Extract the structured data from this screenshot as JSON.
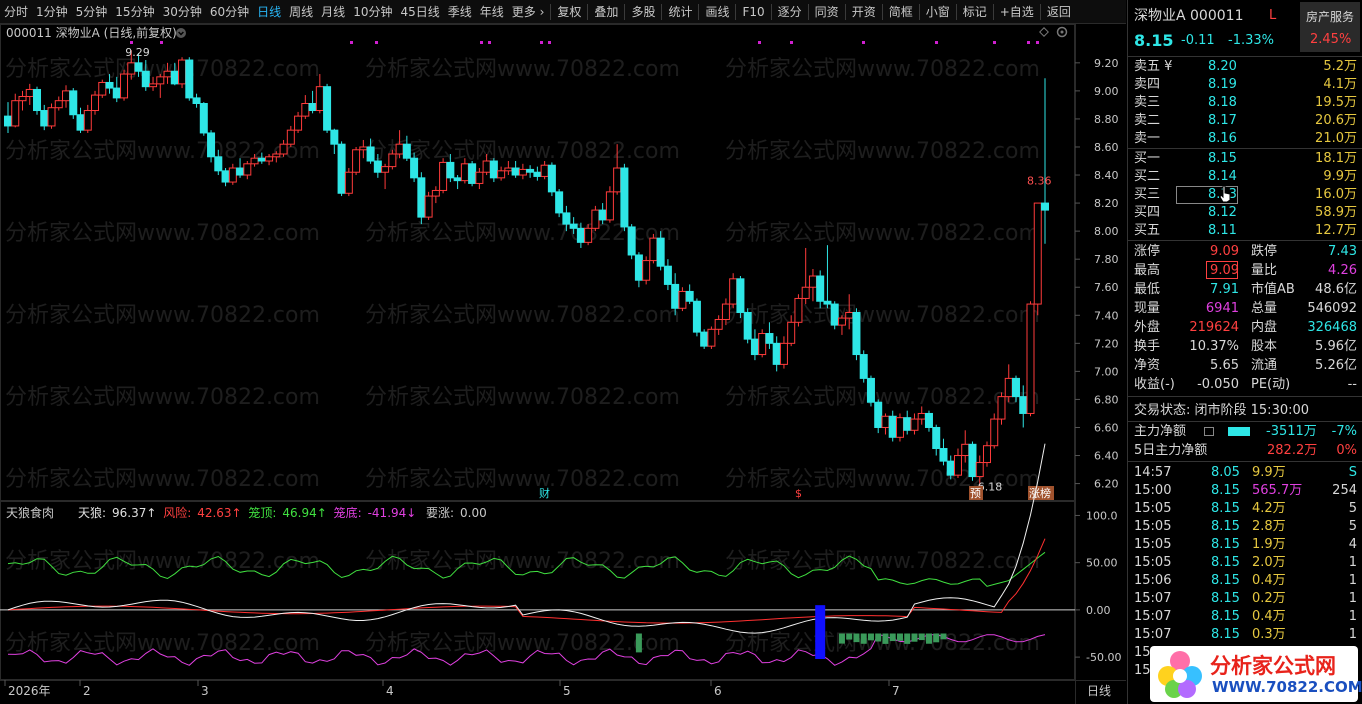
{
  "toolbar": {
    "items": [
      "分时",
      "1分钟",
      "5分钟",
      "15分钟",
      "30分钟",
      "60分钟",
      "日线",
      "周线",
      "月线",
      "10分钟",
      "45日线",
      "季线",
      "年线",
      "更多 ›"
    ],
    "active_index": 6,
    "tools": [
      "复权",
      "叠加",
      "多股",
      "统计",
      "画线",
      "F10",
      "逐分",
      "同资",
      "开资",
      "简框",
      "小窗",
      "标记",
      "+自选",
      "返回"
    ]
  },
  "chart": {
    "title": "000011 深物业A (日线,前复权)",
    "high_label": "9.29",
    "low_label": "6.18",
    "last_label": "8.36",
    "y_ticks": [
      "9.20",
      "9.00",
      "8.80",
      "8.60",
      "8.40",
      "8.20",
      "8.00",
      "7.80",
      "7.60",
      "7.40",
      "7.20",
      "7.00",
      "6.80",
      "6.60",
      "6.40",
      "6.20"
    ],
    "markers": {
      "cai": "财",
      "dollar": "$",
      "yu": "预",
      "zhangting": "涨榜"
    },
    "x_labels": [
      "2026年",
      "2",
      "3",
      "4",
      "5",
      "6",
      "7"
    ],
    "period": "日线",
    "watermark": "分析家公式网www.70822.com"
  },
  "indicator": {
    "name": "天狼食肉",
    "items": [
      {
        "label": "天狼:",
        "value": "96.37↑",
        "color": "#e0e0e0"
      },
      {
        "label": "风险:",
        "value": "42.63↑",
        "color": "#ff4040"
      },
      {
        "label": "笼顶:",
        "value": "46.94↑",
        "color": "#40e040"
      },
      {
        "label": "笼底:",
        "value": "-41.94↓",
        "color": "#e040e0"
      },
      {
        "label": "要涨:",
        "value": "0.00",
        "color": "#c8c8c8"
      }
    ],
    "y_ticks": [
      "100.0",
      "50.00",
      "0.00",
      "-50.00"
    ]
  },
  "quote": {
    "name": "深物业A 000011",
    "flag": "L",
    "sector": "房产服务",
    "sector_pct": "2.45%",
    "price": "8.15",
    "change": "-0.11",
    "change_pct": "-1.33%",
    "sells": [
      {
        "label": "卖五 ¥",
        "price": "8.20",
        "vol": "5.2万"
      },
      {
        "label": "卖四",
        "price": "8.19",
        "vol": "4.1万"
      },
      {
        "label": "卖三",
        "price": "8.18",
        "vol": "19.5万"
      },
      {
        "label": "卖二",
        "price": "8.17",
        "vol": "20.6万"
      },
      {
        "label": "卖一",
        "price": "8.16",
        "vol": "21.0万"
      }
    ],
    "buys": [
      {
        "label": "买一",
        "price": "8.15",
        "vol": "18.1万"
      },
      {
        "label": "买二",
        "price": "8.14",
        "vol": "9.9万"
      },
      {
        "label": "买三",
        "price": "8.13",
        "vol": "16.0万"
      },
      {
        "label": "买四",
        "price": "8.12",
        "vol": "58.9万"
      },
      {
        "label": "买五",
        "price": "8.11",
        "vol": "12.7万"
      }
    ],
    "stats": [
      {
        "l1": "涨停",
        "v1": "9.09",
        "c1": "c-r",
        "l2": "跌停",
        "v2": "7.43",
        "c2": "c-g"
      },
      {
        "l1": "最高",
        "v1": "9.09",
        "c1": "c-r",
        "l2": "量比",
        "v2": "4.26",
        "c2": "c-m"
      },
      {
        "l1": "最低",
        "v1": "7.91",
        "c1": "c-g",
        "l2": "市值AB",
        "v2": "48.6亿",
        "c2": "c-w"
      },
      {
        "l1": "现量",
        "v1": "6941",
        "c1": "c-m",
        "l2": "总量",
        "v2": "546092",
        "c2": "c-w"
      },
      {
        "l1": "外盘",
        "v1": "219624",
        "c1": "c-r",
        "l2": "内盘",
        "v2": "326468",
        "c2": "c-g"
      },
      {
        "l1": "换手",
        "v1": "10.37%",
        "c1": "c-w",
        "l2": "股本",
        "v2": "5.96亿",
        "c2": "c-w"
      },
      {
        "l1": "净资",
        "v1": "5.65",
        "c1": "c-w",
        "l2": "流通",
        "v2": "5.26亿",
        "c2": "c-w"
      },
      {
        "l1": "收益(-)",
        "v1": "-0.050",
        "c1": "c-w",
        "l2": "PE(动)",
        "v2": "--",
        "c2": "c-w"
      }
    ],
    "status": "交易状态: 闭市阶段 15:30:00",
    "main_flow": {
      "label": "主力净额",
      "value": "-3511万",
      "pct": "-7%"
    },
    "main_flow5": {
      "label": "5日主力净额",
      "value": "282.2万",
      "pct": "0%"
    },
    "ticks": [
      {
        "t": "14:57",
        "p": "8.05",
        "v": "9.9万",
        "n": "S",
        "vc": "c-y",
        "nc": "c-g"
      },
      {
        "t": "15:00",
        "p": "8.15",
        "v": "565.7万",
        "n": "254",
        "vc": "c-m",
        "nc": "c-w"
      },
      {
        "t": "15:05",
        "p": "8.15",
        "v": "4.2万",
        "n": "5",
        "vc": "c-y",
        "nc": "c-w"
      },
      {
        "t": "15:05",
        "p": "8.15",
        "v": "2.8万",
        "n": "5",
        "vc": "c-y",
        "nc": "c-w"
      },
      {
        "t": "15:05",
        "p": "8.15",
        "v": "1.9万",
        "n": "4",
        "vc": "c-y",
        "nc": "c-w"
      },
      {
        "t": "15:05",
        "p": "8.15",
        "v": "2.0万",
        "n": "1",
        "vc": "c-y",
        "nc": "c-w"
      },
      {
        "t": "15:06",
        "p": "8.15",
        "v": "0.4万",
        "n": "1",
        "vc": "c-y",
        "nc": "c-w"
      },
      {
        "t": "15:07",
        "p": "8.15",
        "v": "0.2万",
        "n": "1",
        "vc": "c-y",
        "nc": "c-w"
      },
      {
        "t": "15:07",
        "p": "8.15",
        "v": "0.4万",
        "n": "1",
        "vc": "c-y",
        "nc": "c-w"
      },
      {
        "t": "15:07",
        "p": "8.15",
        "v": "0.3万",
        "n": "1",
        "vc": "c-y",
        "nc": "c-w"
      },
      {
        "t": "15",
        "p": "",
        "v": "",
        "n": "",
        "vc": "c-y",
        "nc": "c-w"
      },
      {
        "t": "15",
        "p": "",
        "v": "",
        "n": "",
        "vc": "c-y",
        "nc": "c-w"
      }
    ]
  },
  "logo": {
    "text": "分析家公式网",
    "url": "WWW.70822.COM"
  },
  "colors": {
    "up": "#ff3b3b",
    "down": "#2ee6e6",
    "accent": "#29b6f6",
    "grid": "#1a1a1a"
  },
  "chart_data": {
    "type": "candlestick",
    "ylim": [
      6.2,
      9.29
    ],
    "ohlc": [
      [
        8.82,
        8.92,
        8.7,
        8.75
      ],
      [
        8.75,
        8.98,
        8.74,
        8.93
      ],
      [
        8.93,
        9.0,
        8.86,
        8.96
      ],
      [
        8.96,
        9.05,
        8.9,
        9.01
      ],
      [
        9.01,
        9.03,
        8.83,
        8.86
      ],
      [
        8.86,
        8.9,
        8.72,
        8.75
      ],
      [
        8.75,
        8.91,
        8.73,
        8.88
      ],
      [
        8.88,
        8.96,
        8.86,
        8.93
      ],
      [
        8.93,
        9.04,
        8.88,
        9.0
      ],
      [
        9.0,
        9.02,
        8.8,
        8.83
      ],
      [
        8.83,
        8.88,
        8.7,
        8.72
      ],
      [
        8.72,
        8.9,
        8.7,
        8.86
      ],
      [
        8.86,
        9.0,
        8.83,
        8.97
      ],
      [
        8.97,
        9.08,
        8.95,
        9.06
      ],
      [
        9.06,
        9.12,
        8.98,
        9.02
      ],
      [
        9.02,
        9.1,
        8.92,
        8.95
      ],
      [
        8.95,
        9.15,
        8.93,
        9.12
      ],
      [
        9.12,
        9.29,
        9.08,
        9.2
      ],
      [
        9.2,
        9.27,
        9.1,
        9.14
      ],
      [
        9.14,
        9.22,
        9.0,
        9.03
      ],
      [
        9.03,
        9.1,
        9.0,
        9.05
      ],
      [
        9.05,
        9.12,
        8.95,
        9.1
      ],
      [
        9.1,
        9.2,
        9.05,
        9.14
      ],
      [
        9.14,
        9.2,
        9.04,
        9.05
      ],
      [
        9.05,
        9.24,
        9.02,
        9.22
      ],
      [
        9.22,
        9.24,
        8.93,
        8.95
      ],
      [
        8.95,
        8.98,
        8.88,
        8.91
      ],
      [
        8.91,
        8.92,
        8.68,
        8.7
      ],
      [
        8.7,
        8.72,
        8.49,
        8.53
      ],
      [
        8.53,
        8.58,
        8.4,
        8.43
      ],
      [
        8.43,
        8.45,
        8.32,
        8.35
      ],
      [
        8.35,
        8.48,
        8.33,
        8.45
      ],
      [
        8.45,
        8.52,
        8.38,
        8.4
      ],
      [
        8.4,
        8.5,
        8.37,
        8.48
      ],
      [
        8.48,
        8.55,
        8.46,
        8.52
      ],
      [
        8.52,
        8.56,
        8.48,
        8.5
      ],
      [
        8.5,
        8.55,
        8.47,
        8.53
      ],
      [
        8.53,
        8.57,
        8.49,
        8.55
      ],
      [
        8.55,
        8.65,
        8.53,
        8.62
      ],
      [
        8.62,
        8.75,
        8.6,
        8.72
      ],
      [
        8.72,
        8.85,
        8.7,
        8.82
      ],
      [
        8.82,
        8.97,
        8.8,
        8.91
      ],
      [
        8.91,
        9.0,
        8.84,
        8.86
      ],
      [
        8.86,
        9.12,
        8.84,
        9.03
      ],
      [
        9.03,
        9.05,
        8.7,
        8.72
      ],
      [
        8.72,
        8.73,
        8.55,
        8.62
      ],
      [
        8.62,
        8.64,
        8.25,
        8.27
      ],
      [
        8.27,
        8.45,
        8.25,
        8.42
      ],
      [
        8.42,
        8.6,
        8.4,
        8.58
      ],
      [
        8.58,
        8.65,
        8.52,
        8.6
      ],
      [
        8.6,
        8.66,
        8.48,
        8.5
      ],
      [
        8.5,
        8.55,
        8.38,
        8.42
      ],
      [
        8.42,
        8.48,
        8.3,
        8.46
      ],
      [
        8.46,
        8.58,
        8.44,
        8.55
      ],
      [
        8.55,
        8.72,
        8.52,
        8.62
      ],
      [
        8.62,
        8.68,
        8.5,
        8.52
      ],
      [
        8.52,
        8.56,
        8.35,
        8.38
      ],
      [
        8.38,
        8.42,
        8.05,
        8.1
      ],
      [
        8.1,
        8.28,
        8.08,
        8.25
      ],
      [
        8.25,
        8.32,
        8.2,
        8.29
      ],
      [
        8.29,
        8.52,
        8.27,
        8.49
      ],
      [
        8.49,
        8.55,
        8.35,
        8.38
      ],
      [
        8.38,
        8.4,
        8.3,
        8.36
      ],
      [
        8.36,
        8.52,
        8.34,
        8.48
      ],
      [
        8.48,
        8.5,
        8.32,
        8.34
      ],
      [
        8.34,
        8.45,
        8.3,
        8.42
      ],
      [
        8.42,
        8.55,
        8.4,
        8.5
      ],
      [
        8.5,
        8.52,
        8.35,
        8.38
      ],
      [
        8.38,
        8.46,
        8.36,
        8.43
      ],
      [
        8.43,
        8.5,
        8.4,
        8.45
      ],
      [
        8.45,
        8.5,
        8.38,
        8.4
      ],
      [
        8.4,
        8.48,
        8.37,
        8.44
      ],
      [
        8.44,
        8.47,
        8.38,
        8.42
      ],
      [
        8.42,
        8.46,
        8.36,
        8.39
      ],
      [
        8.39,
        8.5,
        8.37,
        8.47
      ],
      [
        8.47,
        8.49,
        8.25,
        8.28
      ],
      [
        8.28,
        8.3,
        8.1,
        8.13
      ],
      [
        8.13,
        8.18,
        8.0,
        8.05
      ],
      [
        8.05,
        8.1,
        7.98,
        8.02
      ],
      [
        8.02,
        8.06,
        7.88,
        7.92
      ],
      [
        7.92,
        8.05,
        7.9,
        8.02
      ],
      [
        8.02,
        8.18,
        8.0,
        8.15
      ],
      [
        8.15,
        8.2,
        8.05,
        8.08
      ],
      [
        8.08,
        8.32,
        8.06,
        8.28
      ],
      [
        8.28,
        8.62,
        8.26,
        8.45
      ],
      [
        8.45,
        8.48,
        8.0,
        8.03
      ],
      [
        8.03,
        8.05,
        7.8,
        7.83
      ],
      [
        7.83,
        7.85,
        7.6,
        7.65
      ],
      [
        7.65,
        7.82,
        7.62,
        7.79
      ],
      [
        7.79,
        7.98,
        7.77,
        7.95
      ],
      [
        7.95,
        8.0,
        7.72,
        7.75
      ],
      [
        7.75,
        7.8,
        7.58,
        7.62
      ],
      [
        7.62,
        7.7,
        7.4,
        7.45
      ],
      [
        7.45,
        7.6,
        7.43,
        7.57
      ],
      [
        7.57,
        7.62,
        7.48,
        7.5
      ],
      [
        7.5,
        7.52,
        7.25,
        7.28
      ],
      [
        7.28,
        7.3,
        7.16,
        7.18
      ],
      [
        7.18,
        7.32,
        7.16,
        7.3
      ],
      [
        7.3,
        7.4,
        7.26,
        7.37
      ],
      [
        7.37,
        7.52,
        7.33,
        7.48
      ],
      [
        7.48,
        7.7,
        7.45,
        7.66
      ],
      [
        7.66,
        7.68,
        7.38,
        7.42
      ],
      [
        7.42,
        7.45,
        7.2,
        7.23
      ],
      [
        7.23,
        7.3,
        7.08,
        7.12
      ],
      [
        7.12,
        7.3,
        7.1,
        7.27
      ],
      [
        7.27,
        7.35,
        7.16,
        7.2
      ],
      [
        7.2,
        7.25,
        7.0,
        7.05
      ],
      [
        7.05,
        7.25,
        7.02,
        7.2
      ],
      [
        7.2,
        7.4,
        7.18,
        7.35
      ],
      [
        7.35,
        7.55,
        7.32,
        7.52
      ],
      [
        7.52,
        7.88,
        7.48,
        7.6
      ],
      [
        7.6,
        7.73,
        7.5,
        7.68
      ],
      [
        7.68,
        7.72,
        7.45,
        7.5
      ],
      [
        7.5,
        7.9,
        7.45,
        7.48
      ],
      [
        7.48,
        7.5,
        7.3,
        7.33
      ],
      [
        7.33,
        7.4,
        7.26,
        7.38
      ],
      [
        7.38,
        7.55,
        7.3,
        7.42
      ],
      [
        7.42,
        7.45,
        7.08,
        7.12
      ],
      [
        7.12,
        7.15,
        6.92,
        6.95
      ],
      [
        6.95,
        6.97,
        6.75,
        6.78
      ],
      [
        6.78,
        6.8,
        6.56,
        6.6
      ],
      [
        6.6,
        6.7,
        6.55,
        6.68
      ],
      [
        6.68,
        6.72,
        6.5,
        6.53
      ],
      [
        6.53,
        6.7,
        6.5,
        6.67
      ],
      [
        6.67,
        6.72,
        6.55,
        6.58
      ],
      [
        6.58,
        6.7,
        6.55,
        6.66
      ],
      [
        6.66,
        6.75,
        6.62,
        6.7
      ],
      [
        6.7,
        6.72,
        6.57,
        6.6
      ],
      [
        6.6,
        6.62,
        6.4,
        6.45
      ],
      [
        6.45,
        6.52,
        6.33,
        6.36
      ],
      [
        6.36,
        6.4,
        6.23,
        6.26
      ],
      [
        6.26,
        6.45,
        6.24,
        6.4
      ],
      [
        6.4,
        6.58,
        6.35,
        6.48
      ],
      [
        6.48,
        6.5,
        6.22,
        6.25
      ],
      [
        6.25,
        6.4,
        6.18,
        6.35
      ],
      [
        6.35,
        6.5,
        6.32,
        6.47
      ],
      [
        6.47,
        6.7,
        6.45,
        6.66
      ],
      [
        6.66,
        6.85,
        6.62,
        6.82
      ],
      [
        6.82,
        7.05,
        6.78,
        6.95
      ],
      [
        6.95,
        6.97,
        6.78,
        6.82
      ],
      [
        6.82,
        6.9,
        6.6,
        6.7
      ],
      [
        6.7,
        7.5,
        6.68,
        7.48
      ],
      [
        7.48,
        7.9,
        7.4,
        8.2
      ],
      [
        8.2,
        9.09,
        7.91,
        8.15
      ]
    ]
  }
}
